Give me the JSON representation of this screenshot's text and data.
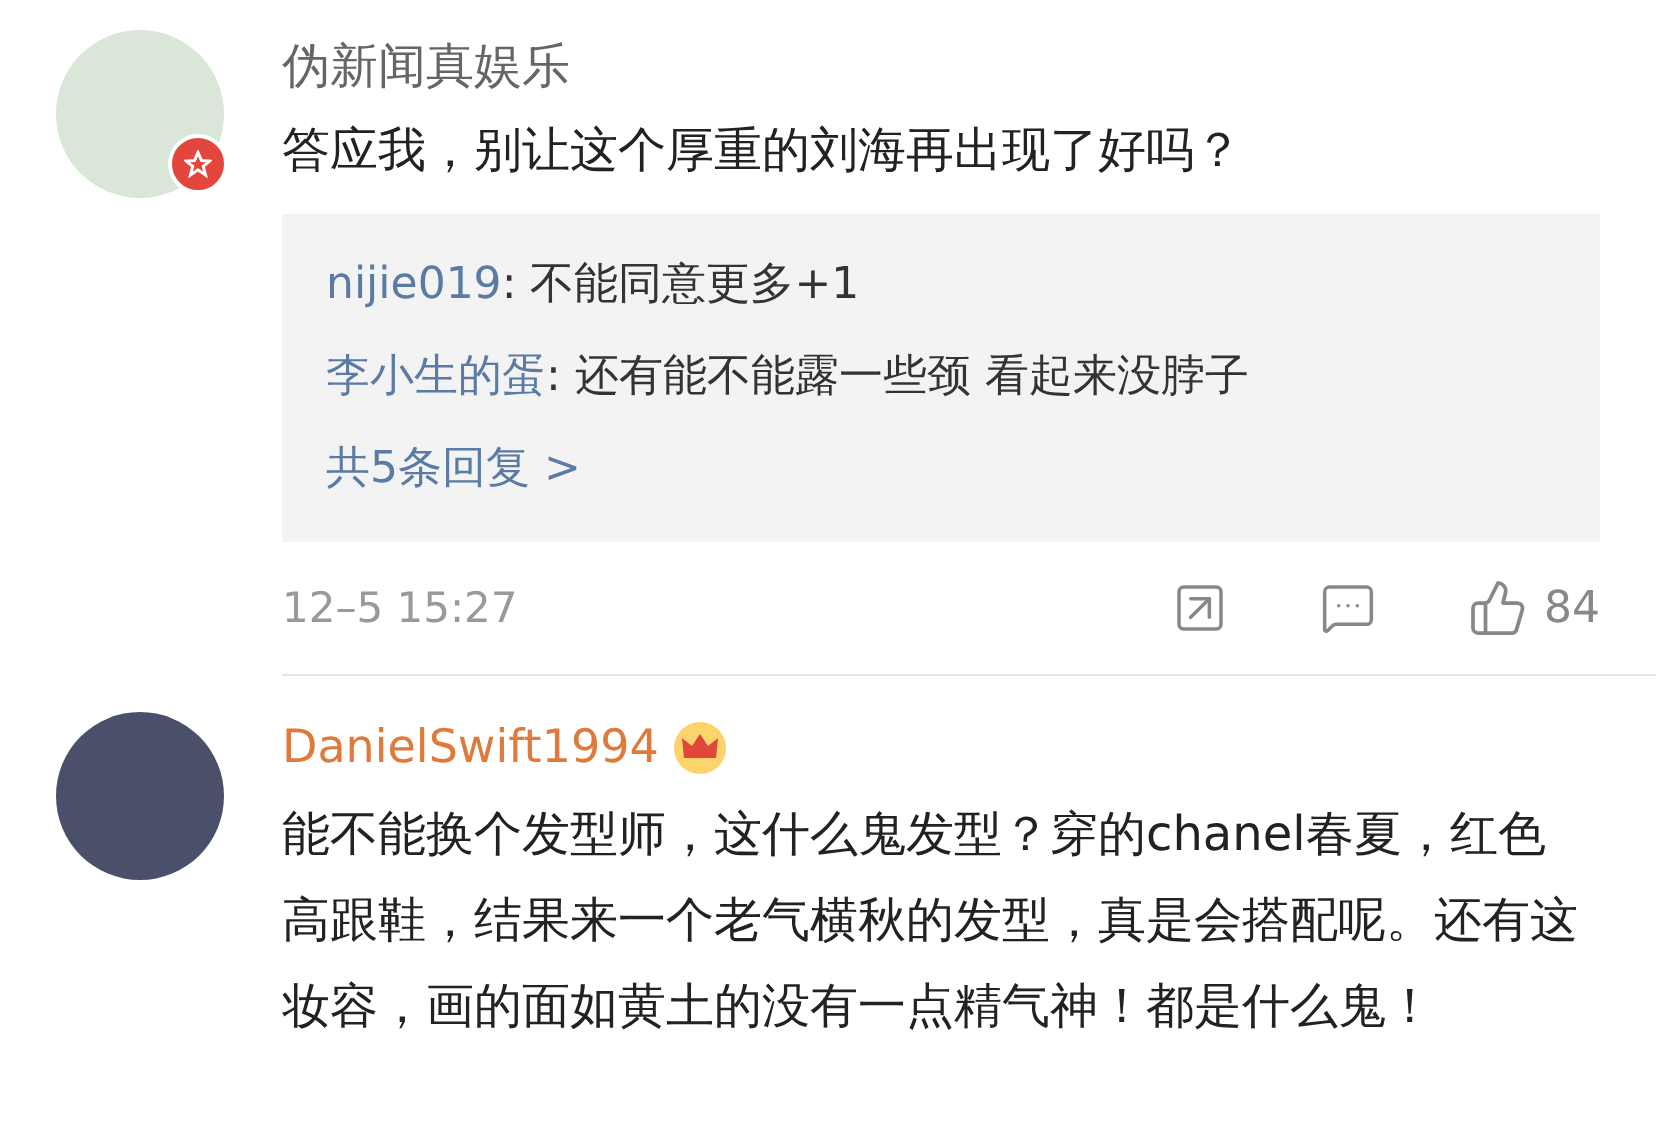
{
  "comments": [
    {
      "author": "伪新闻真娱乐",
      "kind": "verified",
      "text": "答应我，别让这个厚重的刘海再出现了好吗？",
      "replies": [
        {
          "user": "nijie019",
          "text": ": 不能同意更多+1"
        },
        {
          "user": "李小生的蛋",
          "text": ": 还有能不能露一些颈 看起来没脖子"
        }
      ],
      "more_replies": "共5条回复 >",
      "time": "12–5 15:27",
      "likes": "84"
    },
    {
      "author": "DanielSwift1994",
      "kind": "vip",
      "text": "能不能换个发型师，这什么鬼发型？穿的chanel春夏，红色高跟鞋，结果来一个老气横秋的发型，真是会搭配呢。还有这妆容，画的面如黄土的没有一点精气神！都是什么鬼！"
    }
  ]
}
